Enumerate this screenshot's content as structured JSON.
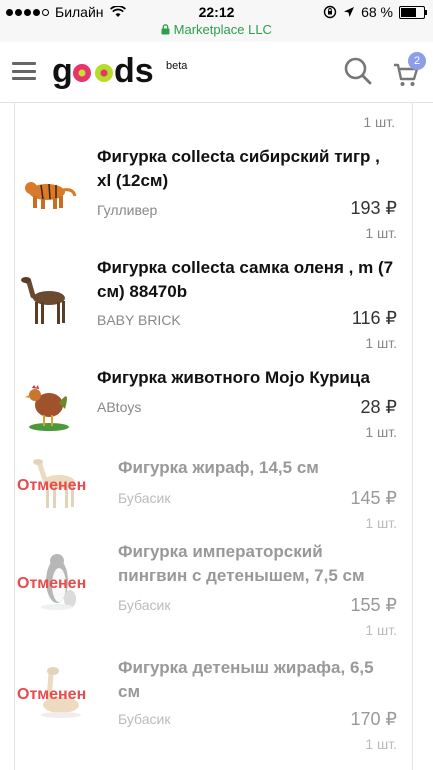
{
  "status": {
    "carrier": "Билайн",
    "time": "22:12",
    "battery": "68 %",
    "url": "Marketplace LLC"
  },
  "header": {
    "logo": "goods",
    "beta": "beta",
    "cart_count": "2"
  },
  "list": {
    "top_qty": "1 шт.",
    "items": [
      {
        "name": "Фигурка collecta сибирский тигр , xl (12см)",
        "seller": "Гулливер",
        "price": "193 ₽",
        "qty": "1 шт.",
        "icon": "tiger-figurine"
      },
      {
        "name": "Фигурка collecta самка оленя , m (7 см) 88470b",
        "seller": "BABY BRICK",
        "price": "116 ₽",
        "qty": "1 шт.",
        "icon": "deer-figurine"
      },
      {
        "name": "Фигурка животного Mojo Курица",
        "seller": "ABtoys",
        "price": "28 ₽",
        "qty": "1 шт.",
        "icon": "chicken-figurine"
      },
      {
        "name": "Фигурка жираф, 14,5 см",
        "seller": "Бубасик",
        "price": "145 ₽",
        "qty": "1 шт.",
        "status": "Отменен",
        "icon": "giraffe-figurine"
      },
      {
        "name": "Фигурка императорский пингвин с детенышем, 7,5 см",
        "seller": "Бубасик",
        "price": "155 ₽",
        "qty": "1 шт.",
        "status": "Отменен",
        "icon": "penguin-figurine"
      },
      {
        "name": "Фигурка детеныш жирафа, 6,5 см",
        "seller": "Бубасик",
        "price": "170 ₽",
        "qty": "1 шт.",
        "status": "Отменен",
        "icon": "baby-giraffe-figurine"
      }
    ]
  },
  "colors": {
    "accent": "#e84b4b",
    "secure": "#2aa04a",
    "badge": "#8c9ee6",
    "logo_dot": "#e8336d",
    "logo_dot2": "#c6e12a"
  }
}
